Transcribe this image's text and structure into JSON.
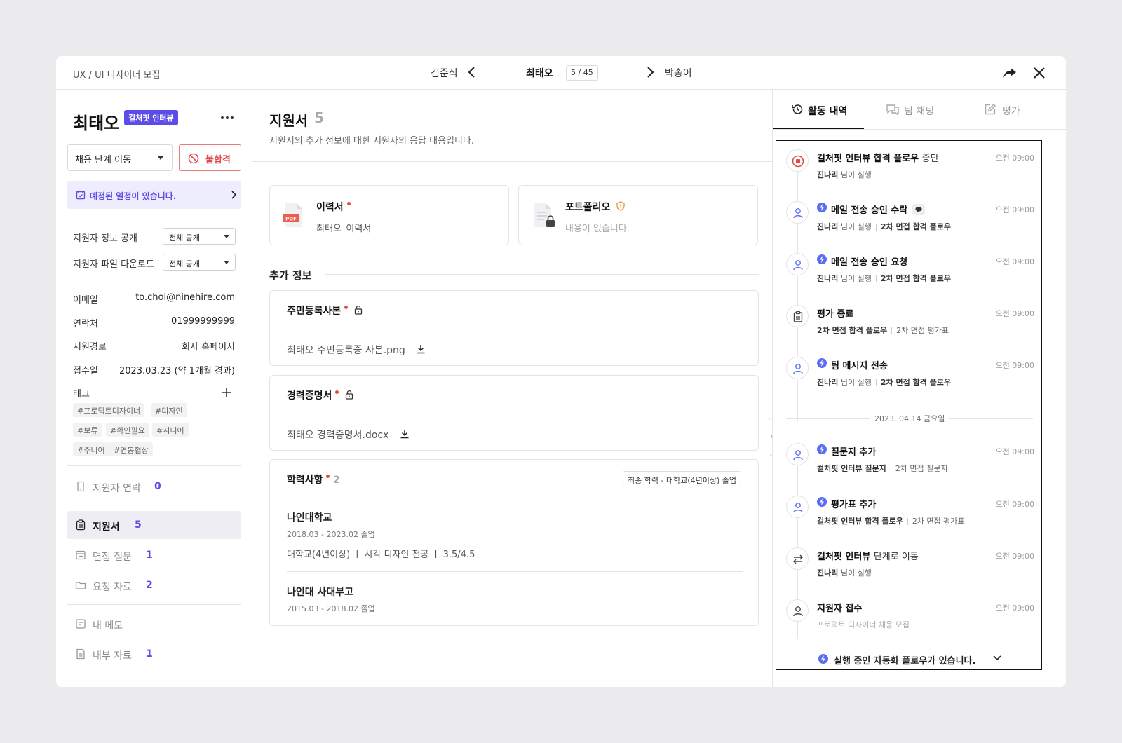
{
  "topbar": {
    "breadcrumb": "UX / UI 디자이너 모집",
    "prev_name": "김준식",
    "current_name": "최태오",
    "counter": "5 / 45",
    "next_name": "박송이"
  },
  "candidate": {
    "name": "최태오",
    "stage_badge": "컬처핏 인터뷰",
    "stage_select": "채용 단계 이동",
    "reject_label": "불합격",
    "schedule_notice": "예정된 일정이 있습니다.",
    "settings": [
      {
        "label": "지원자 정보 공개",
        "value": "전체 공개"
      },
      {
        "label": "지원자 파일 다운로드",
        "value": "전체 공개"
      }
    ],
    "info": [
      {
        "label": "이메일",
        "value": "to.choi@ninehire.com"
      },
      {
        "label": "연락처",
        "value": "01999999999"
      },
      {
        "label": "지원경로",
        "value": "회사 홈페이지"
      },
      {
        "label": "접수일",
        "value": "2023.03.23 (약 1개월 경과)"
      }
    ],
    "tags_label": "태그",
    "tags": [
      "#프로덕트디자이너",
      "#디자인",
      "#보류",
      "#확인필요",
      "#시니어",
      "#주니어",
      "#연봉협상"
    ]
  },
  "menu": [
    {
      "label": "지원자 연락",
      "count": "0"
    },
    {
      "label": "지원서",
      "count": "5"
    },
    {
      "label": "면접 질문",
      "count": "1"
    },
    {
      "label": "요청 자료",
      "count": "2"
    },
    {
      "label": "내 메모",
      "count": ""
    },
    {
      "label": "내부 자료",
      "count": "1"
    }
  ],
  "main": {
    "title": "지원서",
    "title_count": "5",
    "description": "지원서의 추가 정보에 대한 지원자의 응답 내용입니다.",
    "resume_title": "이력서",
    "resume_file": "최태오_이력서",
    "resume_badge": "PDF",
    "portfolio_title": "포트폴리오",
    "portfolio_empty": "내용이 없습니다.",
    "extra_section": "추가 정보",
    "id_doc_title": "주민등록사본",
    "id_doc_file": "최태오 주민등록증 사본.png",
    "career_doc_title": "경력증명서",
    "career_doc_file": "최태오 경력증명서.docx",
    "education_title": "학력사항",
    "education_count": "2",
    "education_badge": "최종 학력 - 대학교(4년이상) 졸업",
    "education": [
      {
        "school": "나인대학교",
        "period": "2018.03 - 2023.02 졸업",
        "detail": "대학교(4년이상)  ㅣ 시각 디자인 전공  ㅣ 3.5/4.5"
      },
      {
        "school": "나인대 사대부고",
        "period": "2015.03 - 2018.02 졸업",
        "detail": ""
      }
    ]
  },
  "right_tabs": [
    "활동 내역",
    "팀 채팅",
    "평가"
  ],
  "activity": [
    {
      "title": "컬처핏 인터뷰 합격 플로우",
      "title_suffix": "중단",
      "time": "오전 09:00",
      "meta_bold": "진나리",
      "meta": "님이 실행",
      "meta2": ""
    },
    {
      "title": "메일 전송 승인 수락",
      "title_suffix": "",
      "time": "오전 09:00",
      "meta_bold": "진나리",
      "meta": "님이 실행",
      "meta2": "2차 면접 합격 플로우"
    },
    {
      "title": "메일 전송 승인 요청",
      "title_suffix": "",
      "time": "오전 09:00",
      "meta_bold": "진나리",
      "meta": "님이 실행",
      "meta2": "2차 면접 합격 플로우"
    },
    {
      "title": "평가 종료",
      "title_suffix": "",
      "time": "오전 09:00",
      "meta_bold": "2차 면접 합격 플로우",
      "meta": "",
      "meta2": "2차 면접 평가표"
    },
    {
      "title": "팀 메시지 전송",
      "title_suffix": "",
      "time": "오전 09:00",
      "meta_bold": "진나리",
      "meta": "님이 실행",
      "meta2": "2차 면접 합격 플로우"
    },
    {
      "title": "질문지 추가",
      "title_suffix": "",
      "time": "오전 09:00",
      "meta_bold": "컬처핏 인터뷰 질문지",
      "meta": "",
      "meta2": "2차 면접 질문지"
    },
    {
      "title": "평가표 추가",
      "title_suffix": "",
      "time": "오전 09:00",
      "meta_bold": "컬처핏 인터뷰 합격 플로우",
      "meta": "",
      "meta2": "2차 면접 평가표"
    },
    {
      "title": "컬처핏 인터뷰",
      "title_suffix": "단계로 이동",
      "time": "오전 09:00",
      "meta_bold": "진나리",
      "meta": "님이 실행",
      "meta2": ""
    },
    {
      "title": "지원자 접수",
      "title_suffix": "",
      "time": "오전 09:00",
      "meta_bold": "",
      "meta": "프로덕트 디자이너 채용 모집",
      "meta2": ""
    }
  ],
  "date_separator": "2023. 04.14 금요일",
  "auto_flow_notice": "실행 중인 자동화 플로우가 있습니다.",
  "colors": {
    "accent": "#5b4de6",
    "danger": "#e14b4b",
    "bolt": "#5b6df0"
  }
}
